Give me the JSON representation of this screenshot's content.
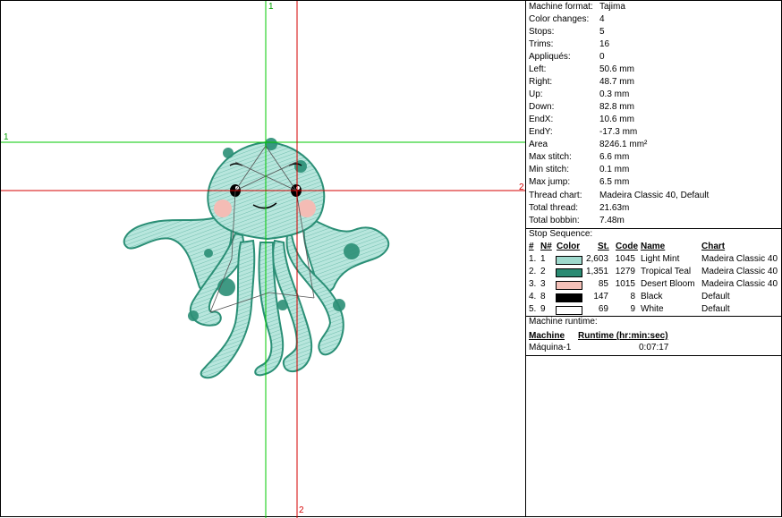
{
  "canvas": {
    "guides": {
      "v_green": "1",
      "h_green": "1",
      "h_red": "2",
      "v_red": "2"
    },
    "colors": {
      "mint": "#a6ded5",
      "teal": "#2b8f76",
      "blush": "#f4bcb5",
      "green_line": "#00c800",
      "red_line": "#d40000"
    }
  },
  "properties": [
    {
      "key": "Machine format:",
      "value": "Tajima"
    },
    {
      "key": "Color changes:",
      "value": "4"
    },
    {
      "key": "Stops:",
      "value": "5"
    },
    {
      "key": "Trims:",
      "value": "16"
    },
    {
      "key": "Appliqués:",
      "value": "0"
    },
    {
      "key": "Left:",
      "value": "50.6 mm"
    },
    {
      "key": "Right:",
      "value": "48.7 mm"
    },
    {
      "key": "Up:",
      "value": "0.3 mm"
    },
    {
      "key": "Down:",
      "value": "82.8 mm"
    },
    {
      "key": "EndX:",
      "value": "10.6 mm"
    },
    {
      "key": "EndY:",
      "value": "-17.3 mm"
    },
    {
      "key": "Area",
      "value": "8246.1 mm²"
    },
    {
      "key": "Max stitch:",
      "value": "6.6 mm"
    },
    {
      "key": "Min stitch:",
      "value": "0.1 mm"
    },
    {
      "key": "Max jump:",
      "value": "6.5 mm"
    },
    {
      "key": "Thread chart:",
      "value": "Madeira Classic 40, Default"
    },
    {
      "key": "Total thread:",
      "value": "21.63m"
    },
    {
      "key": "Total bobbin:",
      "value": "7.48m"
    }
  ],
  "stop_sequence": {
    "title": "Stop Sequence:",
    "headers": {
      "num": "#",
      "n": "N#",
      "color": "Color",
      "st": "St.",
      "code": "Code",
      "name": "Name",
      "chart": "Chart"
    },
    "rows": [
      {
        "num": "1.",
        "n": "1",
        "swatch": "#9fd9cd",
        "st": "2,603",
        "code": "1045",
        "name": "Light Mint",
        "chart": "Madeira Classic 40"
      },
      {
        "num": "2.",
        "n": "2",
        "swatch": "#2a8a72",
        "st": "1,351",
        "code": "1279",
        "name": "Tropical Teal",
        "chart": "Madeira Classic 40"
      },
      {
        "num": "3.",
        "n": "3",
        "swatch": "#f4c0b8",
        "st": "85",
        "code": "1015",
        "name": "Desert Bloom",
        "chart": "Madeira Classic 40"
      },
      {
        "num": "4.",
        "n": "8",
        "swatch": "#000000",
        "st": "147",
        "code": "8",
        "name": "Black",
        "chart": "Default"
      },
      {
        "num": "5.",
        "n": "9",
        "swatch": "#ffffff",
        "st": "69",
        "code": "9",
        "name": "White",
        "chart": "Default"
      }
    ]
  },
  "runtime": {
    "title": "Machine runtime:",
    "headers": {
      "machine": "Machine",
      "runtime": "Runtime (hr:min:sec)"
    },
    "rows": [
      {
        "machine": "Máquina-1",
        "runtime": "0:07:17"
      }
    ]
  }
}
